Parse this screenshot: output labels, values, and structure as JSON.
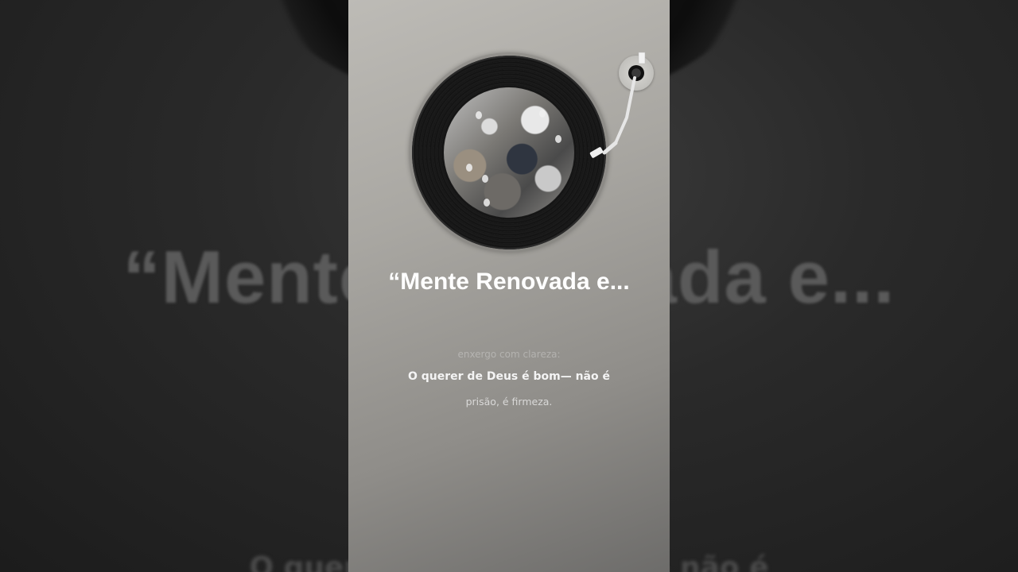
{
  "song": {
    "title": "“Mente Renovada e...",
    "lyrics": {
      "previous": "enxergo com clareza:",
      "current": "O querer de Deus é bom— não é",
      "next": "prisão, é firmeza."
    }
  },
  "backdrop": {
    "title": "“Mente Renovada e...",
    "line_partial": "enxergo com clareza:",
    "line_partial2": "O querer de Deus é bom— não é"
  },
  "icons": {
    "vinyl": "vinyl-record-icon",
    "tonearm": "tonearm-icon"
  },
  "colors": {
    "panel_top": "#bdbbb6",
    "panel_bottom": "#6d6c6a",
    "backdrop": "#1e1e1e",
    "title": "#ffffff"
  }
}
